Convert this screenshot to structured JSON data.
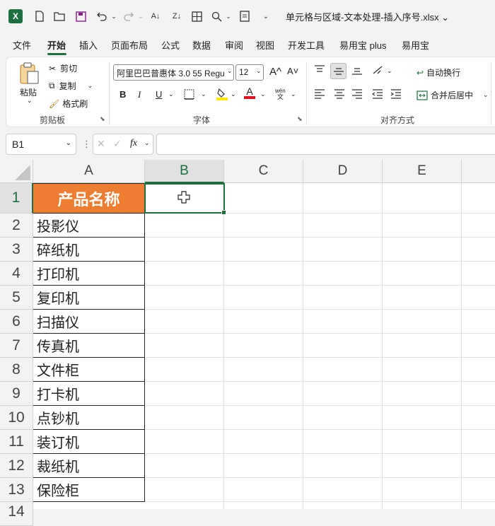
{
  "titlebar": {
    "doc_title": "单元格与区域-文本处理-插入序号.xlsx ⌄",
    "logo": "X"
  },
  "menu": {
    "items": [
      "文件",
      "开始",
      "插入",
      "页面布局",
      "公式",
      "数据",
      "审阅",
      "视图",
      "开发工具",
      "易用宝 plus",
      "易用宝"
    ],
    "active": "开始"
  },
  "ribbon": {
    "paste": "粘贴",
    "cut": "剪切",
    "copy": "复制",
    "format_painter": "格式刷",
    "clipboard_group": "剪贴板",
    "font_name": "阿里巴巴普惠体 3.0 55 Regu",
    "font_size": "12",
    "font_group": "字体",
    "wrap_text": "自动换行",
    "merge_center": "合并后居中",
    "align_group": "对齐方式",
    "grow_font": "A^",
    "shrink_font": "A˅",
    "bold": "B",
    "italic": "I",
    "underline": "U",
    "font_color": "A",
    "phonetic_top": "wén",
    "phonetic_bottom": "文"
  },
  "formula_bar": {
    "name_box": "B1",
    "fx": "fx",
    "value": ""
  },
  "sheet": {
    "columns": [
      "A",
      "B",
      "C",
      "D",
      "E"
    ],
    "rows": [
      "1",
      "2",
      "3",
      "4",
      "5",
      "6",
      "7",
      "8",
      "9",
      "10",
      "11",
      "12",
      "13",
      "14"
    ],
    "colA": [
      "产品名称",
      "投影仪",
      "碎纸机",
      "打印机",
      "复印机",
      "扫描仪",
      "传真机",
      "文件柜",
      "打卡机",
      "点钞机",
      "装订机",
      "裁纸机",
      "保险柜"
    ],
    "selected_cell": "B1",
    "header_color": "#ed7d31",
    "accent_color": "#1d6f42"
  }
}
